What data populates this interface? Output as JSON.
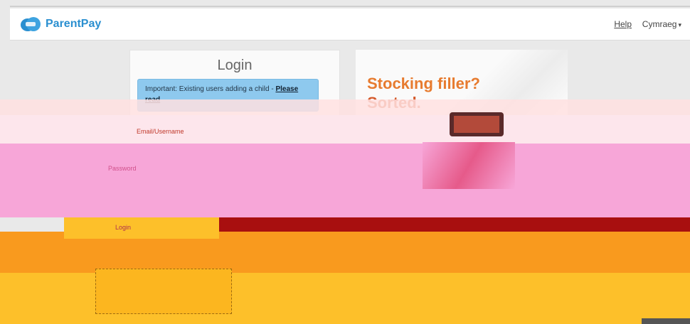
{
  "navbar": {
    "brand": "ParentPay",
    "help_label": "Help",
    "language_label": "Cymraeg",
    "language_caret": "▾",
    "logo_icon": "parentpay-cloud-icon"
  },
  "login": {
    "title": "Login",
    "notice_text": "Important: Existing users adding a child - ",
    "notice_link": "Please read",
    "email_label": "Email/Username",
    "password_label": "Password",
    "login_button": "Login"
  },
  "promo": {
    "headline_line1": "Stocking filler?",
    "headline_line2": "Sorted."
  },
  "colors": {
    "brand_blue": "#2a8fd0",
    "notice_blue": "#8ec9ee",
    "promo_orange": "#e77b2f",
    "glitch_pink": "#f7a6d8",
    "glitch_red": "#a80f0f",
    "glitch_orange": "#f99a1e",
    "glitch_yellow": "#fdc02a"
  }
}
